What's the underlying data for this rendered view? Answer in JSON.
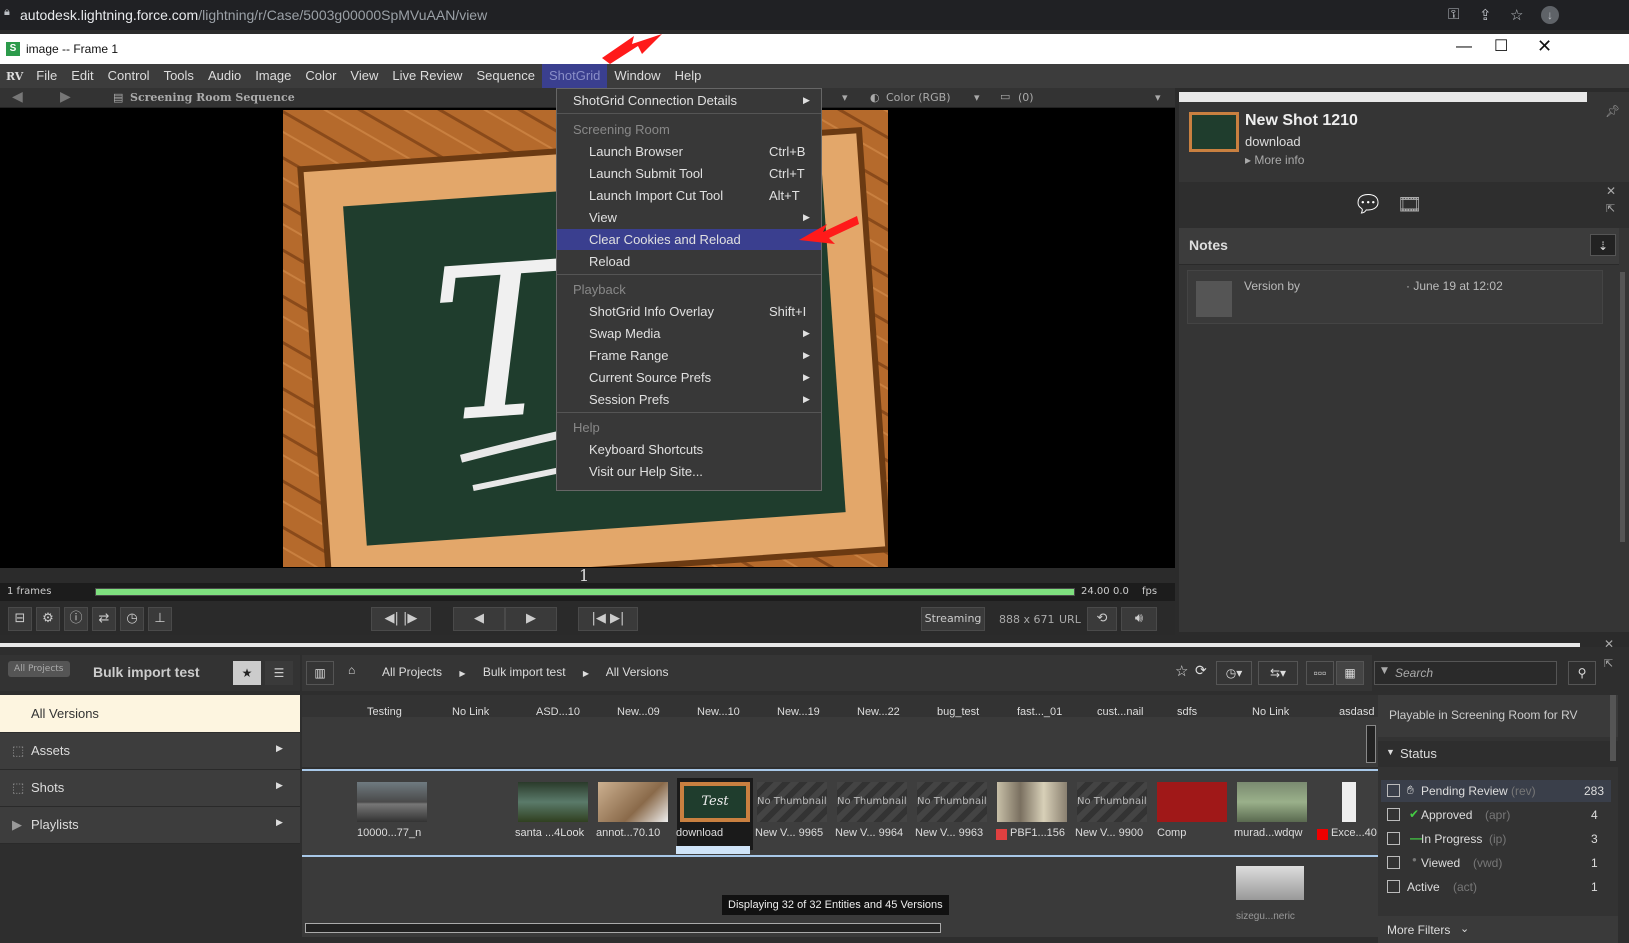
{
  "browser": {
    "url_host": "autodesk.lightning.force.com",
    "url_path": "/lightning/r/Case/5003g00000SpMVuAAN/view"
  },
  "window": {
    "title": "image -- Frame 1"
  },
  "menubar": {
    "logo": "RV",
    "items": [
      "File",
      "Edit",
      "Control",
      "Tools",
      "Audio",
      "Image",
      "Color",
      "View",
      "Live Review",
      "Sequence",
      "ShotGrid",
      "Window",
      "Help"
    ]
  },
  "viewer_bar": {
    "sequence": "Screening Room Sequence",
    "color": "Color (RGB)",
    "count": "(0)"
  },
  "dropdown": {
    "connection": "ShotGrid Connection Details",
    "sections": [
      {
        "header": "Screening Room",
        "items": [
          {
            "label": "Launch Browser",
            "shortcut": "Ctrl+B"
          },
          {
            "label": "Launch Submit Tool",
            "shortcut": "Ctrl+T"
          },
          {
            "label": "Launch Import Cut Tool",
            "shortcut": "Alt+T"
          },
          {
            "label": "View",
            "shortcut": ""
          },
          {
            "label": "Clear Cookies and Reload",
            "shortcut": ""
          },
          {
            "label": "Reload",
            "shortcut": ""
          }
        ]
      },
      {
        "header": "Playback",
        "items": [
          {
            "label": "ShotGrid Info Overlay",
            "shortcut": "Shift+I"
          },
          {
            "label": "Swap Media",
            "shortcut": ""
          },
          {
            "label": "Frame Range",
            "shortcut": ""
          },
          {
            "label": "Current Source Prefs",
            "shortcut": ""
          },
          {
            "label": "Session Prefs",
            "shortcut": ""
          }
        ]
      },
      {
        "header": "Help",
        "items": [
          {
            "label": "Keyboard Shortcuts",
            "shortcut": ""
          },
          {
            "label": "Visit our Help Site...",
            "shortcut": ""
          }
        ]
      }
    ]
  },
  "viewer": {
    "frame_number": "1",
    "frames": "1 frames",
    "fps_value": "24.00",
    "fps_extra": "0.0",
    "fps_label": "fps"
  },
  "transport": {
    "streaming": "Streaming",
    "resolution": "888 x 671",
    "url": "URL"
  },
  "shot_panel": {
    "title": "New Shot 1210",
    "subtitle": "download",
    "more_info": "More info",
    "notes_header": "Notes",
    "note_author": "Version by",
    "note_date": "· June 19 at 12:02"
  },
  "bottom": {
    "all_projects_tag": "All Projects",
    "project_title": "Bulk import test",
    "sidebar": {
      "all_versions": "All Versions",
      "items": [
        "Assets",
        "Shots",
        "Playlists"
      ]
    },
    "breadcrumb": [
      "All Projects",
      "Bulk import test",
      "All Versions"
    ],
    "search_placeholder": "Search",
    "columns": [
      "Testing",
      "No Link",
      "ASD...10",
      "New...09",
      "New...10",
      "New...19",
      "New...22",
      "bug_test",
      "fast..._01",
      "cust...nail",
      "sdfs",
      "No Link",
      "asdasd"
    ],
    "thumbs": [
      {
        "label": "10000...77_n",
        "kind": "road"
      },
      {
        "label": "santa ...4Look",
        "kind": "landscape"
      },
      {
        "label": "annot...70.10",
        "kind": "building"
      },
      {
        "label": "download",
        "kind": "chalk"
      },
      {
        "label": "New V... 9965",
        "kind": "none"
      },
      {
        "label": "New V... 9964",
        "kind": "none"
      },
      {
        "label": "New V... 9963",
        "kind": "none"
      },
      {
        "label": "PBF1...156",
        "kind": "city"
      },
      {
        "label": "New V... 9900",
        "kind": "none"
      },
      {
        "label": "Comp",
        "kind": "red"
      },
      {
        "label": "murad...wdqw",
        "kind": "garden"
      },
      {
        "label": "Exce...40",
        "kind": "white"
      }
    ],
    "no_thumbnail": "No Thumbnail",
    "extra_thumb_label": "sizegu...neric",
    "status_text": "Displaying 32 of 32 Entities and 45 Versions"
  },
  "filters": {
    "title": "Playable in Screening Room for RV",
    "status_header": "Status",
    "rows": [
      {
        "label": "Pending Review",
        "code": "(rev)",
        "count": "283"
      },
      {
        "label": "Approved",
        "code": "(apr)",
        "count": "4"
      },
      {
        "label": "In Progress",
        "code": "(ip)",
        "count": "3"
      },
      {
        "label": "Viewed",
        "code": "(vwd)",
        "count": "1"
      },
      {
        "label": "Active",
        "code": "(act)",
        "count": "1"
      }
    ],
    "more_filters": "More Filters"
  },
  "colors": {
    "highlight": "#3a3f8f",
    "progress": "#7fe07f",
    "arrow_red": "#ff1a1a"
  }
}
